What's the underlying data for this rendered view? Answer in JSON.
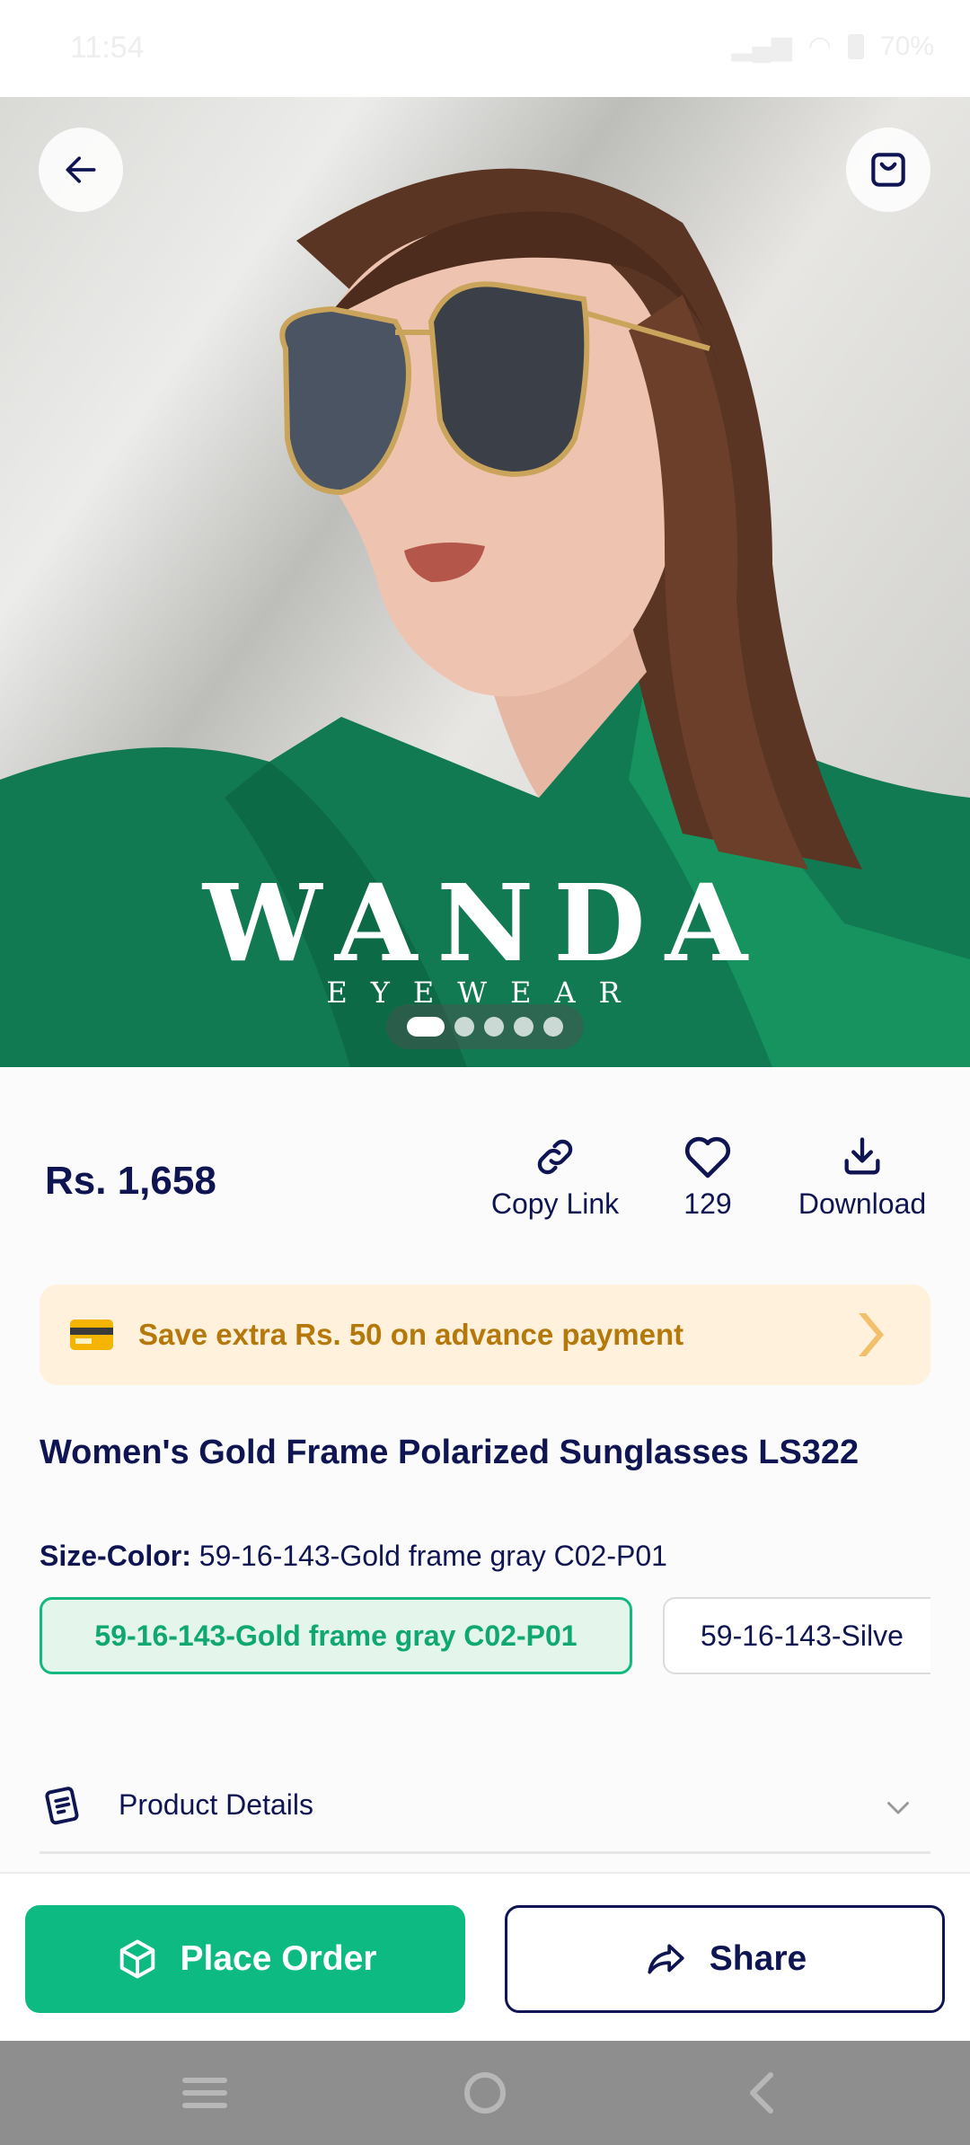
{
  "status_bar": {
    "time": "11:54",
    "battery": "70%"
  },
  "hero": {
    "brand_name": "WANDA",
    "brand_sub": "EYEWEAR",
    "image_count": 5,
    "active_index": 0
  },
  "product": {
    "price": "Rs. 1,658",
    "title": "Women's Gold Frame Polarized Sunglasses LS322"
  },
  "actions": {
    "copy_link": "Copy Link",
    "likes": "129",
    "download": "Download"
  },
  "promo": {
    "text": "Save extra Rs. 50 on advance payment"
  },
  "variant": {
    "label": "Size-Color:",
    "selected": "59-16-143-Gold frame gray C02-P01",
    "options": [
      "59-16-143-Gold frame gray C02-P01",
      "59-16-143-Silve"
    ]
  },
  "details": {
    "label": "Product Details"
  },
  "buttons": {
    "order": "Place Order",
    "share": "Share"
  },
  "colors": {
    "primary": "#0dbb82",
    "navy": "#0f1552",
    "promo_bg": "#fff1dc",
    "promo_text": "#b5780a"
  },
  "icons": [
    "back-arrow-icon",
    "shopping-bag-icon",
    "link-icon",
    "heart-icon",
    "download-icon",
    "credit-card-icon",
    "chevron-right-icon",
    "document-icon",
    "chevron-down-icon",
    "box-icon",
    "share-icon",
    "menu-icon",
    "home-circle-icon",
    "back-nav-icon"
  ]
}
